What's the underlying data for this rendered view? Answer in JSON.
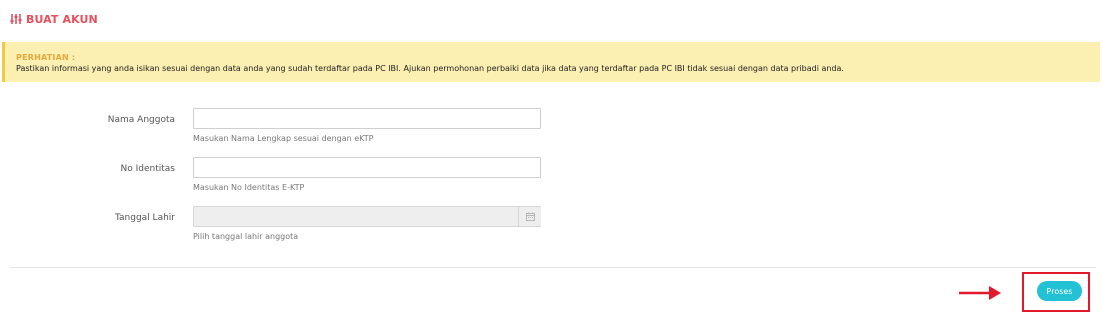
{
  "header": {
    "icon": "sliders-icon",
    "title": "BUAT AKUN",
    "color": "#e4505d"
  },
  "alert": {
    "title": "PERHATIAN :",
    "text": "Pastikan informasi yang anda isikan sesuai dengan data anda yang sudah terdaftar pada PC IBI. Ajukan permohonan perbaiki data jika data yang terdaftar pada PC IBI tidak sesuai dengan data pribadi anda.",
    "background": "#fbefb2",
    "title_color": "#e3a93a"
  },
  "form": {
    "nama_anggota": {
      "label": "Nama Anggota",
      "value": "",
      "help": "Masukan Nama Lengkap sesuai dengan eKTP"
    },
    "no_identitas": {
      "label": "No Identitas",
      "value": "",
      "help": "Masukan No Identitas E-KTP"
    },
    "tanggal_lahir": {
      "label": "Tanggal Lahir",
      "value": "",
      "help": "Pilih tanggal lahir anggota",
      "icon": "calendar-icon"
    }
  },
  "actions": {
    "submit_label": "Proses",
    "submit_color": "#23c1d4",
    "annotation_color": "#e3182b",
    "annotation_icon": "arrow-right-icon"
  }
}
